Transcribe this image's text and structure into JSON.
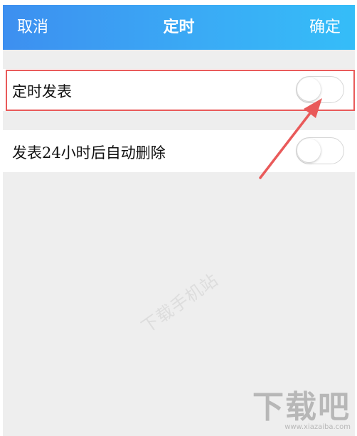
{
  "header": {
    "cancel_label": "取消",
    "title": "定时",
    "confirm_label": "确定"
  },
  "settings": [
    {
      "label": "定时发表",
      "enabled": false,
      "highlighted": true
    },
    {
      "label": "发表24小时后自动删除",
      "enabled": false,
      "highlighted": false
    }
  ],
  "watermark": {
    "center_text": "下载手机站",
    "logo_text": "下载吧",
    "logo_url": "www.xiazaiba.com"
  },
  "colors": {
    "header_start": "#3d8ff0",
    "header_end": "#35bdf8",
    "annotation": "#e95a5a",
    "background": "#eeeeee"
  },
  "icons": {
    "toggle": "toggle-switch-off",
    "annotation_arrow": "arrow-pointing-up-right"
  }
}
